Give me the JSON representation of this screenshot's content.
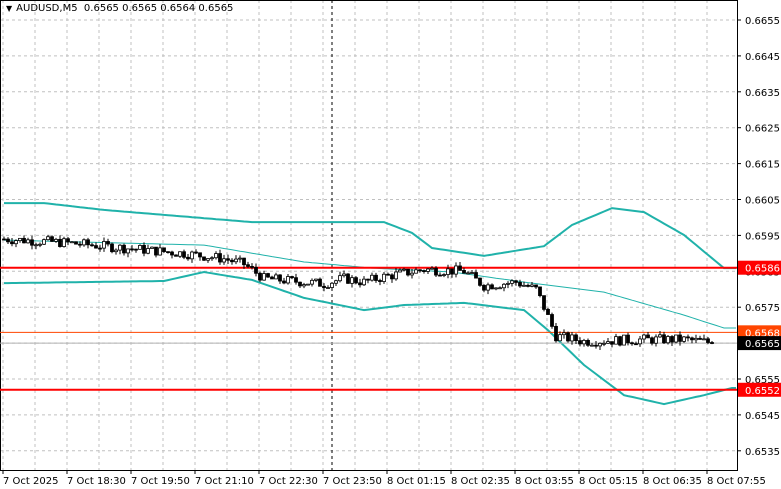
{
  "header": {
    "symbol": "AUDUSD,M5",
    "ohlc": "0.6565 0.6565 0.6564 0.6565"
  },
  "colors": {
    "band": "#20b2aa",
    "resistance": "#ff0000",
    "level": "#ff4500",
    "bid": "#000000",
    "grid": "#c0c0c0"
  },
  "chart_data": {
    "type": "candlestick",
    "title": "AUDUSD,M5",
    "ylim": [
      0.653,
      0.666
    ],
    "y_ticks": [
      "0.6655",
      "0.6645",
      "0.6635",
      "0.6625",
      "0.6615",
      "0.6605",
      "0.6595",
      "0.6585",
      "0.6575",
      "0.6565",
      "0.6555",
      "0.6545",
      "0.6535"
    ],
    "x_labels": [
      {
        "bar": 0,
        "label": "7 Oct 2025"
      },
      {
        "bar": 16,
        "label": "7 Oct 18:30"
      },
      {
        "bar": 32,
        "label": "7 Oct 19:50"
      },
      {
        "bar": 48,
        "label": "7 Oct 21:10"
      },
      {
        "bar": 64,
        "label": "7 Oct 22:30"
      },
      {
        "bar": 80,
        "label": "7 Oct 23:50"
      },
      {
        "bar": 96,
        "label": "8 Oct 01:15"
      },
      {
        "bar": 112,
        "label": "8 Oct 02:35"
      },
      {
        "bar": 128,
        "label": "8 Oct 03:55"
      },
      {
        "bar": 144,
        "label": "8 Oct 05:15"
      },
      {
        "bar": 160,
        "label": "8 Oct 06:35"
      },
      {
        "bar": 176,
        "label": "8 Oct 07:55"
      }
    ],
    "bar_count": 178,
    "close_anchors": [
      [
        0,
        0.6594
      ],
      [
        15,
        0.6593
      ],
      [
        30,
        0.65915
      ],
      [
        45,
        0.659
      ],
      [
        55,
        0.65885
      ],
      [
        60,
        0.6587
      ],
      [
        65,
        0.6583
      ],
      [
        80,
        0.65815
      ],
      [
        85,
        0.6583
      ],
      [
        90,
        0.6582
      ],
      [
        95,
        0.65835
      ],
      [
        105,
        0.65855
      ],
      [
        115,
        0.6585
      ],
      [
        120,
        0.6581
      ],
      [
        128,
        0.6582
      ],
      [
        133,
        0.658
      ],
      [
        135,
        0.6575
      ],
      [
        138,
        0.6567
      ],
      [
        145,
        0.65655
      ],
      [
        160,
        0.6566
      ],
      [
        170,
        0.6566
      ],
      [
        178,
        0.6565
      ]
    ],
    "bollinger": {
      "upper": [
        [
          0,
          0.6604
        ],
        [
          10,
          0.6604
        ],
        [
          25,
          0.66021
        ],
        [
          50,
          0.65998
        ],
        [
          62,
          0.65987
        ],
        [
          95,
          0.65987
        ],
        [
          102,
          0.65957
        ],
        [
          107,
          0.65915
        ],
        [
          120,
          0.65893
        ],
        [
          135,
          0.6592
        ],
        [
          142,
          0.65979
        ],
        [
          152,
          0.66026
        ],
        [
          160,
          0.66015
        ],
        [
          170,
          0.65951
        ],
        [
          180,
          0.65859
        ]
      ],
      "middle": [
        [
          0,
          0.65937
        ],
        [
          50,
          0.65923
        ],
        [
          75,
          0.65876
        ],
        [
          92,
          0.65859
        ],
        [
          112,
          0.65848
        ],
        [
          130,
          0.6582
        ],
        [
          150,
          0.65792
        ],
        [
          170,
          0.65728
        ],
        [
          180,
          0.65692
        ]
      ],
      "lower": [
        [
          0,
          0.65817
        ],
        [
          40,
          0.65823
        ],
        [
          50,
          0.65848
        ],
        [
          62,
          0.65826
        ],
        [
          75,
          0.65776
        ],
        [
          90,
          0.65742
        ],
        [
          100,
          0.65756
        ],
        [
          115,
          0.65762
        ],
        [
          130,
          0.65742
        ],
        [
          136,
          0.65686
        ],
        [
          145,
          0.65589
        ],
        [
          155,
          0.65505
        ],
        [
          165,
          0.6548
        ],
        [
          175,
          0.65505
        ],
        [
          182,
          0.65525
        ]
      ]
    },
    "levels": [
      {
        "price": 0.6586,
        "label": "0.6586",
        "kind": "resistance"
      },
      {
        "price": 0.6568,
        "label": "0.6568",
        "kind": "level"
      },
      {
        "price": 0.6565,
        "label": "0.6565",
        "kind": "bid"
      },
      {
        "price": 0.6552,
        "label": "0.6552",
        "kind": "resistance"
      }
    ],
    "cursor_bar": 82
  }
}
